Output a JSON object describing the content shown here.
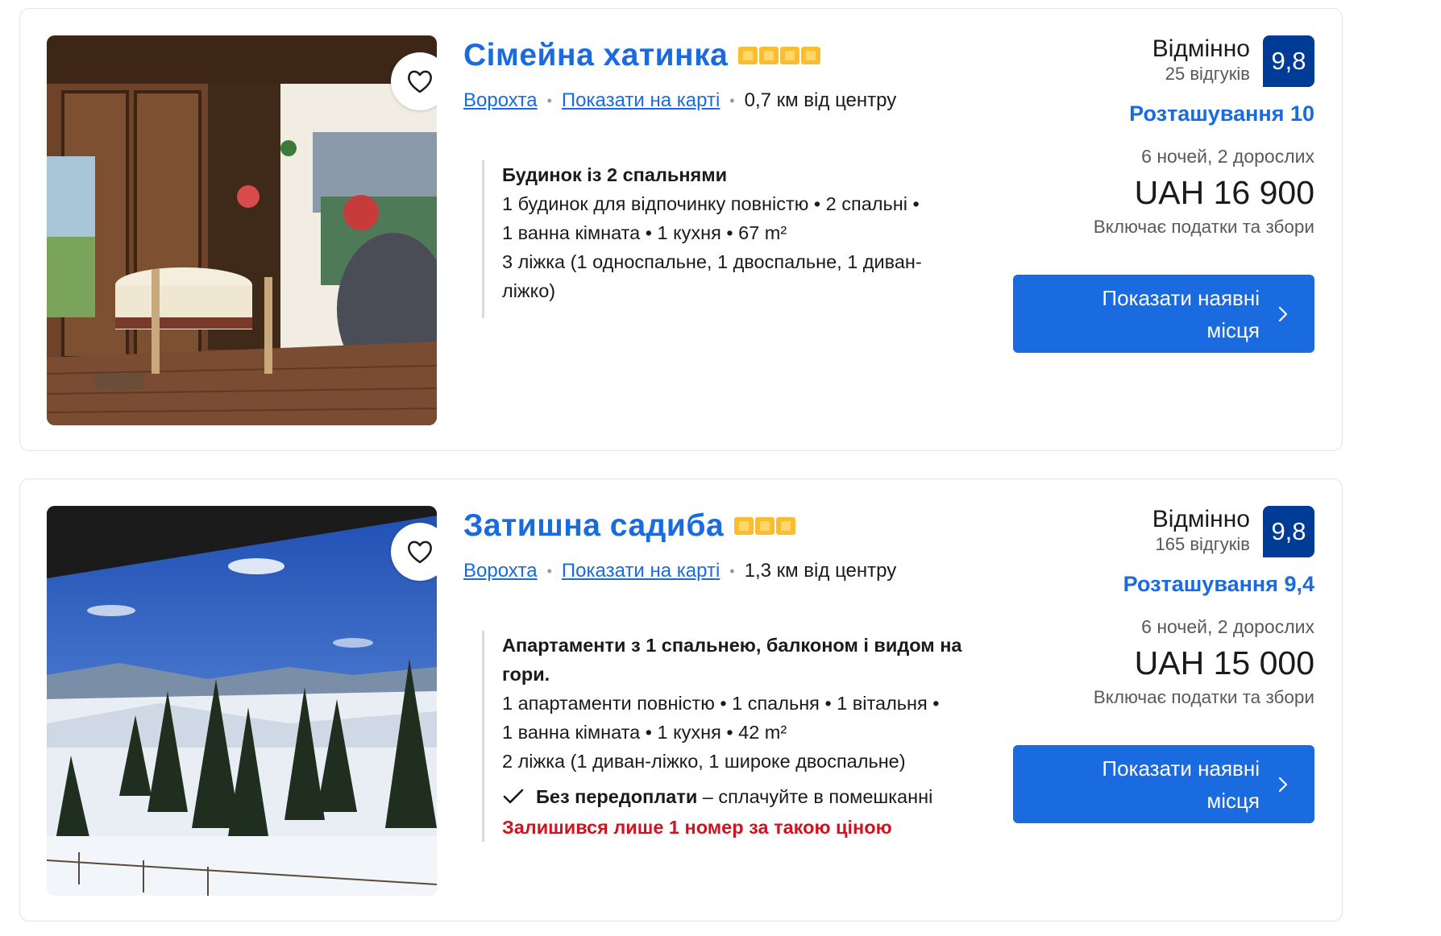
{
  "listings": [
    {
      "title": "Сімейна хатинка",
      "stars": 4,
      "town": "Ворохта",
      "map_link": "Показати на карті",
      "distance": "0,7 км від центру",
      "room_name": "Будинок із 2 спальнями",
      "details": [
        "1 будинок для відпочинку повністю • 2 спальні •",
        "1 ванна кімната • 1 кухня • 67 m²",
        "3 ліжка (1 односпальне, 1 двоспальне, 1 диван-",
        "ліжко)"
      ],
      "score_word": "Відмінно",
      "reviews": "25 відгуків",
      "score": "9,8",
      "location_score": "Розташування 10",
      "nights": "6 ночей, 2 дорослих",
      "price": "UAH 16 900",
      "taxes": "Включає податки та збори",
      "cta": "Показати наявні місця",
      "photo_icon": "wooden-porch-photo"
    },
    {
      "title": "Затишна садиба",
      "stars": 3,
      "town": "Ворохта",
      "map_link": "Показати на карті",
      "distance": "1,3 км від центру",
      "room_name_lines": [
        "Апартаменти з 1 спальнею, балконом і видом на",
        "гори."
      ],
      "details": [
        "1 апартаменти повністю • 1 спальня • 1 вітальня •",
        "1 ванна кімната • 1 кухня • 42 m²",
        "2 ліжка (1 диван-ліжко, 1 широке двоспальне)"
      ],
      "notice_bold": "Без передоплати",
      "notice_rest": " – сплачуйте в помешканні",
      "scarcity": "Залишився лише 1 номер за такою ціною",
      "score_word": "Відмінно",
      "reviews": "165 відгуків",
      "score": "9,8",
      "location_score": "Розташування 9,4",
      "nights": "6 ночей, 2 дорослих",
      "price": "UAH 15 000",
      "taxes": "Включає податки та збори",
      "cta": "Показати наявні місця",
      "photo_icon": "snowy-mountain-photo"
    }
  ],
  "colors": {
    "link": "#1a6ae0",
    "badge": "#003b95",
    "star": "#fbbd2f",
    "alert": "#d4111e"
  },
  "icons": {
    "favorite": "heart-icon",
    "chevron": "chevron-right-icon",
    "check": "check-icon"
  }
}
